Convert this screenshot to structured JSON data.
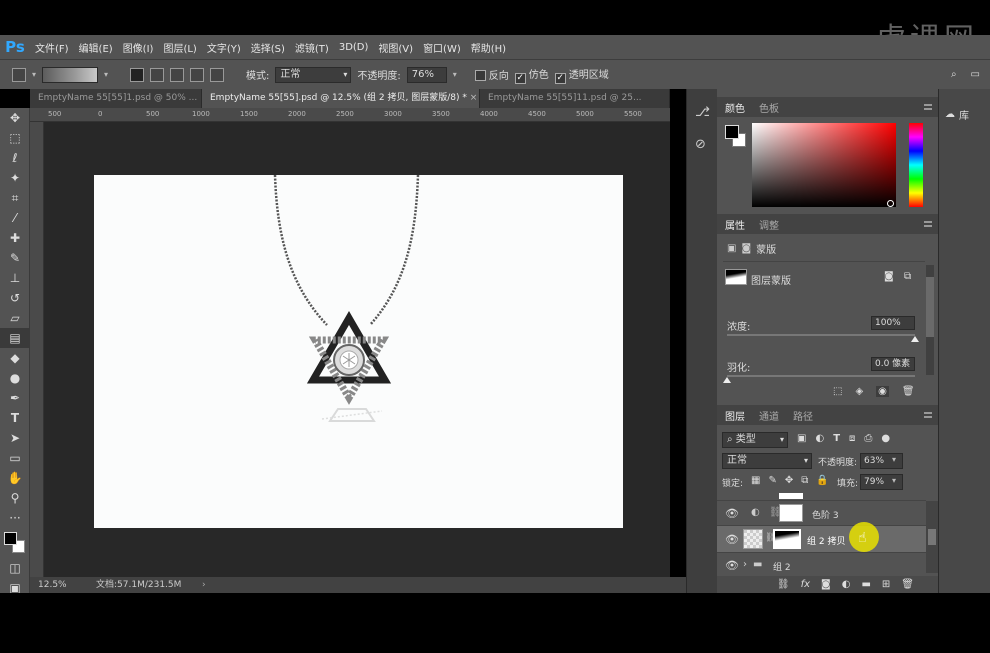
{
  "watermark": "虎课网",
  "app_logo": "Ps",
  "menu": [
    "文件(F)",
    "编辑(E)",
    "图像(I)",
    "图层(L)",
    "文字(Y)",
    "选择(S)",
    "滤镜(T)",
    "3D(D)",
    "视图(V)",
    "窗口(W)",
    "帮助(H)"
  ],
  "options": {
    "mode_label": "模式:",
    "mode_value": "正常",
    "opacity_label": "不透明度:",
    "opacity_value": "76%",
    "reverse_label": "反向",
    "dither_label": "仿色",
    "transparency_label": "透明区域"
  },
  "tabs": [
    "EmptyName 55[55]1.psd @ 50% ...",
    "EmptyName 55[55].psd @ 12.5% (组 2 拷贝, 图层蒙版/8) *",
    "EmptyName 55[55]11.psd @ 25..."
  ],
  "ruler_ticks": [
    "500",
    "0",
    "500",
    "1000",
    "1500",
    "2000",
    "2500",
    "3000",
    "3500",
    "4000",
    "4500",
    "5000",
    "5500"
  ],
  "status": {
    "zoom": "12.5%",
    "doc": "文档:57.1M/231.5M"
  },
  "color_panel": {
    "tabs": [
      "颜色",
      "色板"
    ]
  },
  "properties_panel": {
    "tabs": [
      "属性",
      "调整"
    ],
    "mask_type": "蒙版",
    "layer_mask_label": "图层蒙版",
    "density_label": "浓度:",
    "density_value": "100%",
    "density_level": 1.0,
    "feather_label": "羽化:",
    "feather_value": "0.0 像素",
    "feather_level": 0.0
  },
  "layers_panel": {
    "tabs": [
      "图层",
      "通道",
      "路径"
    ],
    "filter_kind": "类型",
    "blend_mode": "正常",
    "opacity_label": "不透明度:",
    "opacity_value": "63%",
    "lock_label": "锁定:",
    "fill_label": "填充:",
    "fill_value": "79%",
    "layers": [
      {
        "name": "色阶 3"
      },
      {
        "name": "组 2 拷贝"
      },
      {
        "name": "组 2"
      }
    ]
  },
  "library_label": "库",
  "colors": {
    "accent": "#31a8ff",
    "bg": "#535353",
    "canvas": "#fbfcfc",
    "cursor_highlight": "#e8e000"
  }
}
